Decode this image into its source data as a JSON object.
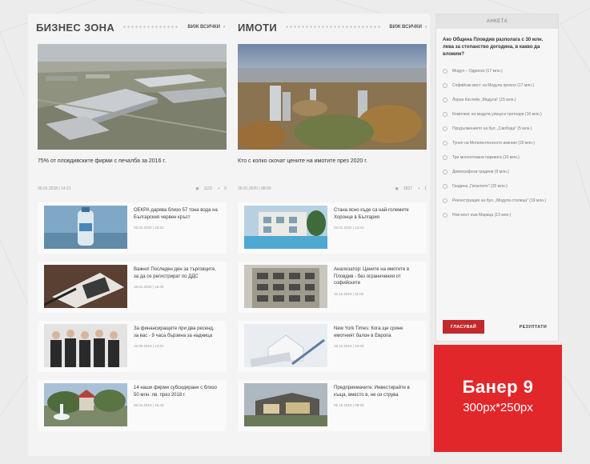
{
  "business": {
    "title": "БИЗНЕС ЗОНА",
    "more": "ВИЖ ВСИЧКИ",
    "feature": {
      "title": "75% от пловдивските фирми с печалба за 2016 г.",
      "date": "30.01.2018 | 14:21",
      "views": "1115",
      "comments": "0"
    },
    "items": [
      {
        "title": "ОЕКРА дарява близо 57 тона вода на Българския червен кръст",
        "date": "03.04.2020 | 15:21"
      },
      {
        "title": "Важно! Последен ден за търговците, за да се регистрират по ДДС",
        "date": "15.01.2020 | 16:00"
      },
      {
        "title": "За финансиращите при два ресенд, за вас - 9 часа бързина за надница",
        "date": "15.09.2019 | 12:01"
      },
      {
        "title": "14 наши фирми субсидирани с близо 50 млн. лв. през 2018 г.",
        "date": "08.04.2019 | 16:40"
      }
    ]
  },
  "property": {
    "title": "ИМОТИ",
    "more": "ВИЖ ВСИЧКИ",
    "feature": {
      "title": "Кто с колко скочат цените на имотите през 2020 г.",
      "date": "30.01.2020 | 08:00",
      "views": "2827",
      "comments": "1"
    },
    "items": [
      {
        "title": "Стана ясно къде са най-големите Хоронце в България",
        "date": "04.01.2020 | 13:41"
      },
      {
        "title": "Анализатор: Цените на имотите в Пловдив - без ограничения от софийските",
        "date": "15.10.2019 | 11:00"
      },
      {
        "title": "New York Times: Кога ще срине имотният балон в Европа",
        "date": "18.10.2019 | 10:00"
      },
      {
        "title": "Предприемачите: Инвестирайте в къща, вместо в, не си струва",
        "date": "05.10.2019 | 09:00"
      }
    ]
  },
  "poll": {
    "head": "АНКЕТА",
    "question": "Ако Община Пловдив разполага с 30 млн. лева за стопанство догодина, в какво да вложим?",
    "options": [
      "Модул – Одриско (17 млн.)",
      "Софийски мост на Модула прохол (17 млн.)",
      "Лоран Кастейн „Модула\" (15 млн.)",
      "Комплекс на модула улица и тротоари (16 млн.)",
      "Продължението на бул. „Свобода\" (5 млн.)",
      "Тунел на Могилентенското имение (20 млн.)",
      "Три многоетажни паркинга (10 млн.)",
      "Демографски градини (9 млн.)",
      "Градина „Гигантите\" (25 млн.)",
      "Реконструкция на бул. „Модула столица\" (19 млн.)",
      "Нов мост към Марица (13 млн.)"
    ],
    "vote_label": "ГЛАСУВАЙ",
    "results_label": "РЕЗУЛТАТИ"
  },
  "banner": {
    "title": "Банер 9",
    "size": "300px*250px"
  },
  "colors": {
    "accent": "#e2272a",
    "vote": "#c3282b",
    "page_bg": "#ececec"
  }
}
